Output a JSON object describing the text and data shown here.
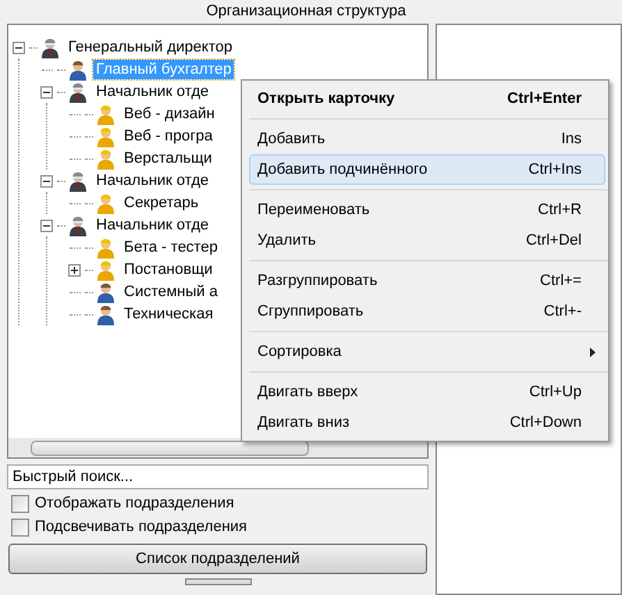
{
  "window": {
    "title": "Организационная структура"
  },
  "tree": [
    {
      "label": "Генеральный директор",
      "kind": "manager",
      "expanded": true,
      "selected": false,
      "children": [
        {
          "label": "Главный бухгалтер",
          "kind": "staff",
          "selected": true
        },
        {
          "label": "Начальник отде",
          "kind": "manager",
          "expanded": true,
          "selected": false,
          "children": [
            {
              "label": "Веб - дизайн",
              "kind": "worker",
              "selected": false
            },
            {
              "label": "Веб - програ",
              "kind": "worker",
              "selected": false
            },
            {
              "label": "Верстальщи",
              "kind": "worker",
              "selected": false
            }
          ]
        },
        {
          "label": "Начальник отде",
          "kind": "manager",
          "expanded": true,
          "selected": false,
          "children": [
            {
              "label": "Секретарь",
              "kind": "worker",
              "selected": false
            }
          ]
        },
        {
          "label": "Начальник отде",
          "kind": "manager",
          "expanded": true,
          "selected": false,
          "children": [
            {
              "label": "Бета - тестер",
              "kind": "worker",
              "selected": false
            },
            {
              "label": "Постановщи",
              "kind": "worker",
              "expanded": false,
              "selected": false
            },
            {
              "label": "Системный а",
              "kind": "staff",
              "selected": false
            },
            {
              "label": "Техническая",
              "kind": "staff",
              "selected": false
            }
          ]
        }
      ]
    }
  ],
  "search": {
    "placeholder": "Быстрый поиск..."
  },
  "options": [
    {
      "label": "Отображать подразделения",
      "checked": false
    },
    {
      "label": "Подсвечивать подразделения",
      "checked": false
    }
  ],
  "list_button": "Список подразделений",
  "context_menu": {
    "groups": [
      [
        {
          "label": "Открыть карточку",
          "shortcut": "Ctrl+Enter",
          "bold": true,
          "selected": false
        }
      ],
      [
        {
          "label": "Добавить",
          "shortcut": "Ins",
          "selected": false
        },
        {
          "label": "Добавить подчинённого",
          "shortcut": "Ctrl+Ins",
          "selected": true
        }
      ],
      [
        {
          "label": "Переименовать",
          "shortcut": "Ctrl+R",
          "selected": false
        },
        {
          "label": "Удалить",
          "shortcut": "Ctrl+Del",
          "selected": false
        }
      ],
      [
        {
          "label": "Разгруппировать",
          "shortcut": "Ctrl+=",
          "selected": false
        },
        {
          "label": "Сгруппировать",
          "shortcut": "Ctrl+-",
          "selected": false
        }
      ],
      [
        {
          "label": "Сортировка",
          "submenu": true,
          "selected": false
        }
      ],
      [
        {
          "label": "Двигать вверх",
          "shortcut": "Ctrl+Up",
          "selected": false
        },
        {
          "label": "Двигать вниз",
          "shortcut": "Ctrl+Down",
          "selected": false
        }
      ]
    ]
  }
}
